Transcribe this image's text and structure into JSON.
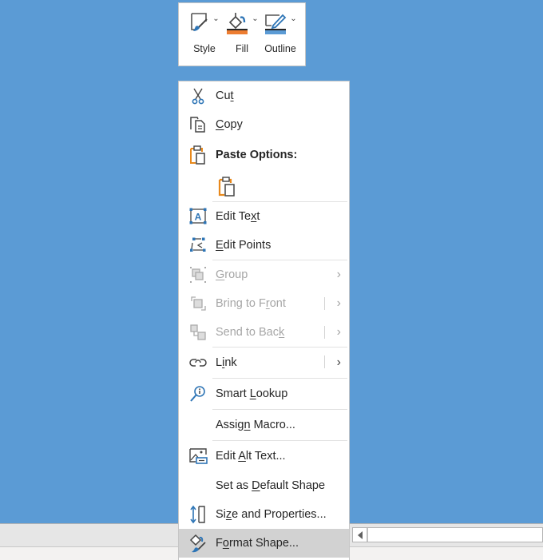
{
  "colors": {
    "background": "#5b9bd5",
    "fill_swatch": "#ed7d31",
    "outline_swatch": "#5b9bd5",
    "accent_icon": "#2e75b6",
    "paste_orange": "#e8891c",
    "hover": "#d2d2d2",
    "disabled_text": "#a6a6a6"
  },
  "mini_toolbar": {
    "buttons": [
      {
        "label": "Style",
        "icon": "shape-style-icon"
      },
      {
        "label": "Fill",
        "icon": "paint-bucket-icon"
      },
      {
        "label": "Outline",
        "icon": "pen-outline-icon"
      }
    ]
  },
  "context_menu": {
    "items": [
      {
        "label_pre": "Cu",
        "label_key": "t",
        "label_post": "",
        "icon": "scissors-icon",
        "enabled": true
      },
      {
        "label_pre": "",
        "label_key": "C",
        "label_post": "opy",
        "icon": "copy-icon",
        "enabled": true
      },
      {
        "label": "Paste Options:",
        "icon": "paste-icon",
        "header": true
      },
      {
        "icon": "paste-keep-formatting-icon",
        "option": true
      },
      {
        "label_pre": "Edit Te",
        "label_key": "x",
        "label_post": "t",
        "icon": "edit-text-icon",
        "enabled": true
      },
      {
        "label_pre": "",
        "label_key": "E",
        "label_post": "dit Points",
        "icon": "edit-points-icon",
        "enabled": true
      },
      {
        "label_pre": "",
        "label_key": "G",
        "label_post": "roup",
        "icon": "group-icon",
        "enabled": false,
        "submenu": true
      },
      {
        "label_pre": "Bring to F",
        "label_key": "r",
        "label_post": "ont",
        "icon": "bring-to-front-icon",
        "enabled": false,
        "submenu": true,
        "split": true
      },
      {
        "label_pre": "Send to Bac",
        "label_key": "k",
        "label_post": "",
        "icon": "send-to-back-icon",
        "enabled": false,
        "submenu": true,
        "split": true
      },
      {
        "label_pre": "L",
        "label_key": "i",
        "label_post": "nk",
        "icon": "link-icon",
        "enabled": true,
        "submenu": true,
        "split": true
      },
      {
        "label_pre": "Smart ",
        "label_key": "L",
        "label_post": "ookup",
        "icon": "smart-lookup-icon",
        "enabled": true
      },
      {
        "label_pre": "Assig",
        "label_key": "n",
        "label_post": " Macro...",
        "icon": null,
        "enabled": true
      },
      {
        "label_pre": "Edit ",
        "label_key": "A",
        "label_post": "lt Text...",
        "icon": "alt-text-icon",
        "enabled": true
      },
      {
        "label_pre": "Set as ",
        "label_key": "D",
        "label_post": "efault Shape",
        "icon": null,
        "enabled": true
      },
      {
        "label_pre": "Si",
        "label_key": "z",
        "label_post": "e and Properties...",
        "icon": "size-properties-icon",
        "enabled": true
      },
      {
        "label_pre": "F",
        "label_key": "o",
        "label_post": "rmat Shape...",
        "icon": "format-shape-icon",
        "enabled": true,
        "hovered": true
      }
    ]
  }
}
